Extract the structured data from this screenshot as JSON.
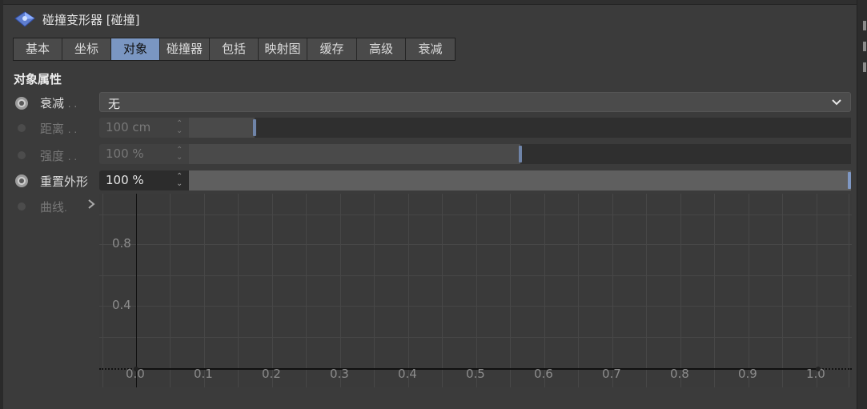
{
  "title": "碰撞变形器 [碰撞]",
  "tabs": [
    {
      "label": "基本",
      "active": false
    },
    {
      "label": "坐标",
      "active": false
    },
    {
      "label": "对象",
      "active": true
    },
    {
      "label": "碰撞器",
      "active": false
    },
    {
      "label": "包括",
      "active": false
    },
    {
      "label": "映射图",
      "active": false
    },
    {
      "label": "缓存",
      "active": false
    },
    {
      "label": "高级",
      "active": false
    },
    {
      "label": "衰减",
      "active": false
    }
  ],
  "section_title": "对象属性",
  "properties": {
    "falloff": {
      "label": "衰减",
      "value": "无",
      "enabled": true
    },
    "distance": {
      "label": "距离",
      "value": "100 cm",
      "slider_fraction": 0.1,
      "enabled": false
    },
    "strength": {
      "label": "强度",
      "value": "100 %",
      "slider_fraction": 0.5,
      "enabled": false
    },
    "restore_shape": {
      "label": "重置外形",
      "value": "100 %",
      "slider_fraction": 1.0,
      "enabled": true
    },
    "curve": {
      "label": "曲线",
      "enabled": false
    }
  },
  "label_ellipsis": ". .",
  "curve_graph": {
    "y_ticks": [
      "0.8",
      "0.4"
    ],
    "x_ticks": [
      "0.0",
      "0.1",
      "0.2",
      "0.3",
      "0.4",
      "0.5",
      "0.6",
      "0.7",
      "0.8",
      "0.9",
      "1.0"
    ]
  },
  "colors": {
    "accent_tab": "#7a96c2",
    "slider_handle": "#6f84a8"
  }
}
